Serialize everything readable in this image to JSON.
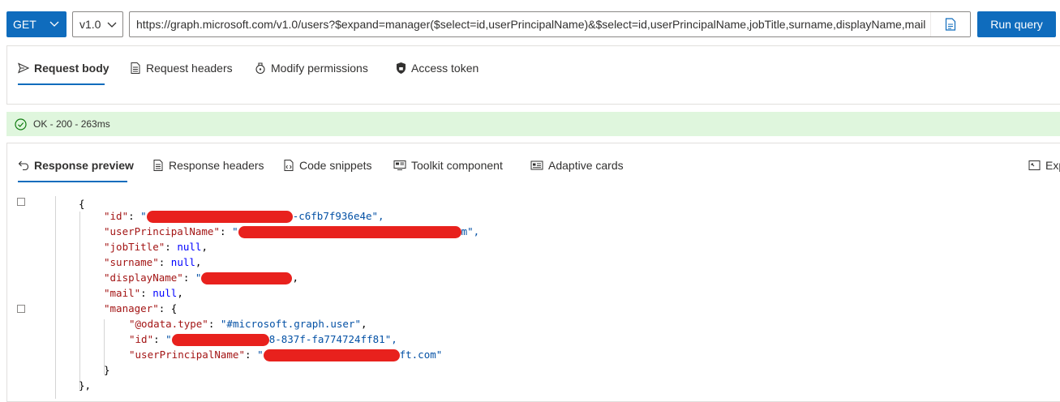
{
  "query": {
    "method": "GET",
    "version": "v1.0",
    "url": "https://graph.microsoft.com/v1.0/users?$expand=manager($select=id,userPrincipalName)&$select=id,userPrincipalName,jobTitle,surname,displayName,mail",
    "run_label": "Run query"
  },
  "request_tabs": [
    {
      "label": "Request body"
    },
    {
      "label": "Request headers"
    },
    {
      "label": "Modify permissions"
    },
    {
      "label": "Access token"
    }
  ],
  "status": {
    "text": "OK - 200 - 263ms"
  },
  "response_tabs": [
    {
      "label": "Response preview"
    },
    {
      "label": "Response headers"
    },
    {
      "label": "Code snippets"
    },
    {
      "label": "Toolkit component"
    },
    {
      "label": "Adaptive cards"
    },
    {
      "label": "Exp"
    }
  ],
  "code": {
    "open_brace": "{",
    "id_key": "\"id\"",
    "id_tail": "-c6fb7f936e4e\",",
    "id_head": "\"",
    "upn_key": "\"userPrincipalName\"",
    "upn_head": "\"",
    "upn_tail": "m\",",
    "jobtitle_key": "\"jobTitle\"",
    "surname_key": "\"surname\"",
    "displayname_key": "\"displayName\"",
    "displayname_head": "\"",
    "displayname_tail": ",",
    "mail_key": "\"mail\"",
    "null_val": "null",
    "manager_key": "\"manager\"",
    "odata_key": "\"@odata.type\"",
    "odata_val": "\"#microsoft.graph.user\"",
    "mgr_id_key": "\"id\"",
    "mgr_id_head": "\"",
    "mgr_id_tail": "8-837f-fa774724ff81\",",
    "mgr_upn_key": "\"userPrincipalName\"",
    "mgr_upn_head": "\"",
    "mgr_upn_tail": "ft.com\"",
    "close_inner": "}",
    "close_outer": "},"
  },
  "colors": {
    "accent": "#0f6cbd",
    "success_bg": "#dff6dd",
    "redaction": "#e8211d"
  }
}
